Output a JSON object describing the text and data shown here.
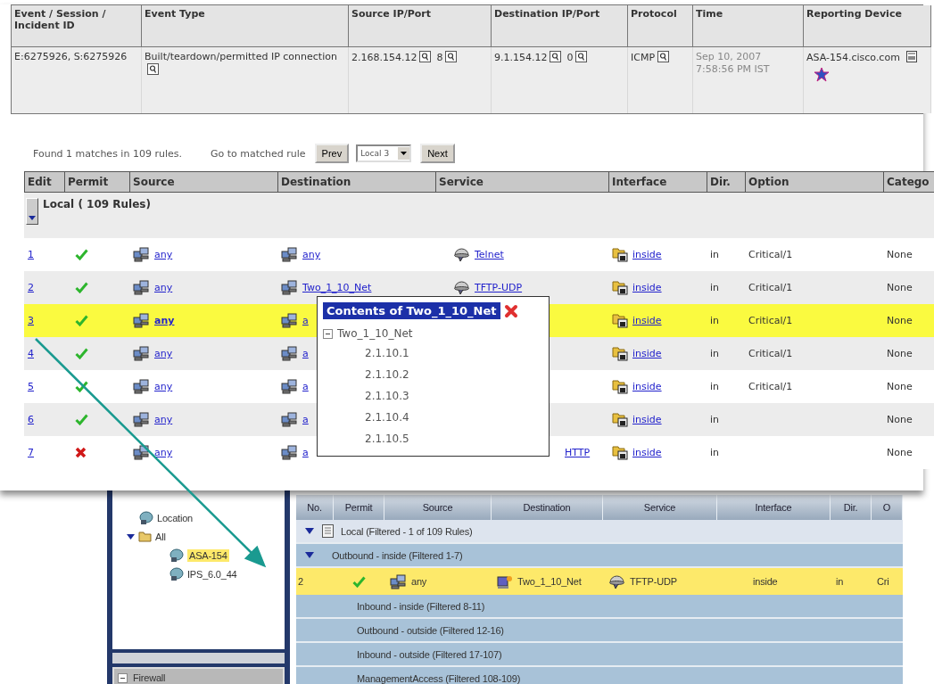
{
  "events_table": {
    "columns": [
      "Event / Session / Incident ID",
      "Event Type",
      "Source IP/Port",
      "Destination IP/Port",
      "Protocol",
      "Time",
      "Reporting Device"
    ],
    "rows": [
      {
        "cells": [
          {
            "text": "E:6275926, S:6275926",
            "query": false
          },
          {
            "text": "Built/teardown/permitted IP connection",
            "query": true
          },
          {
            "text": "2.168.154.12",
            "query": true,
            "port": "8"
          },
          {
            "text": "9.1.154.12",
            "query": true,
            "port": "0"
          },
          {
            "text": "ICMP",
            "query": true
          },
          {
            "text": "Sep 10, 2007 7:58:56 PM IST",
            "query": false
          },
          {
            "text": "ASA-154.cisco.com",
            "query": false
          }
        ]
      }
    ]
  },
  "rule_search": {
    "summary": "Found 1 matches in 109 rules.",
    "goto_label": "Go to matched rule",
    "prev": "Prev",
    "select_value": "Local 3",
    "next": "Next"
  },
  "rules_table": {
    "columns": [
      "Edit",
      "Permit",
      "Source",
      "Destination",
      "Service",
      "Interface",
      "Dir.",
      "Option",
      "Catego"
    ],
    "group": {
      "label": "Local ( 109 Rules)",
      "expanded": true
    },
    "rows": [
      {
        "number": "1",
        "permit": true,
        "source": "any",
        "destination": "any",
        "service": "Telnet",
        "interface": "inside",
        "direction": "in",
        "option": "Critical/1",
        "category": "None",
        "selected": false
      },
      {
        "number": "2",
        "permit": true,
        "source": "any",
        "destination": "Two_1_10_Net",
        "service": "TFTP-UDP",
        "interface": "inside",
        "direction": "in",
        "option": "Critical/1",
        "category": "None",
        "selected": false
      },
      {
        "number": "3",
        "permit": true,
        "source": "any",
        "destination": "a",
        "interface": "inside",
        "direction": "in",
        "option": "Critical/1",
        "category": "None",
        "selected": true
      },
      {
        "number": "4",
        "permit": true,
        "source": "any",
        "destination": "a",
        "interface": "inside",
        "direction": "in",
        "option": "Critical/1",
        "category": "None",
        "selected": false
      },
      {
        "number": "5",
        "permit": true,
        "source": "any",
        "destination": "a",
        "interface": "inside",
        "direction": "in",
        "option": "Critical/1",
        "category": "None",
        "selected": false
      },
      {
        "number": "6",
        "permit": true,
        "source": "any",
        "destination": "a",
        "interface": "inside",
        "direction": "in",
        "category": "None",
        "selected": false
      },
      {
        "number": "7",
        "permit": false,
        "source": "any",
        "destination": "a",
        "service": "HTTP",
        "interface": "inside",
        "direction": "in",
        "category": "None",
        "selected": false
      }
    ]
  },
  "popup": {
    "title": "Contents of Two_1_10_Net",
    "root": {
      "label": "Two_1_10_Net",
      "expanded": true,
      "children": [
        {
          "label": "2.1.10.1"
        },
        {
          "label": "2.1.10.2"
        },
        {
          "label": "2.1.10.3"
        },
        {
          "label": "2.1.10.4"
        },
        {
          "label": "2.1.10.5"
        }
      ]
    }
  },
  "device_panel": {
    "tree": [
      {
        "label": "Location",
        "expanded": false,
        "selected": false
      },
      {
        "label": "All",
        "expanded": true,
        "selected": false,
        "children": [
          {
            "label": "ASA-154",
            "selected": true
          },
          {
            "label": "IPS_6.0_44",
            "selected": false
          }
        ]
      }
    ],
    "footer": "Firewall"
  },
  "policy_table": {
    "columns": [
      "No.",
      "Permit",
      "Source",
      "Destination",
      "Service",
      "Interface",
      "Dir.",
      "O"
    ],
    "rows": [
      {
        "kind": "group",
        "label": "Local (Filtered - 1 of 109 Rules)",
        "expanded": true,
        "selected": false
      },
      {
        "kind": "subgroup",
        "label": "Outbound - inside (Filtered 1-7)",
        "expanded": true,
        "selected": false
      },
      {
        "kind": "rule",
        "number": "2",
        "permit": true,
        "source": "any",
        "destination": "Two_1_10_Net",
        "service": "TFTP-UDP",
        "interface": "inside",
        "direction": "in",
        "option": "Cri",
        "selected": true
      },
      {
        "kind": "subgroup",
        "label": "Inbound - inside (Filtered 8-11)",
        "expanded": false,
        "selected": false
      },
      {
        "kind": "subgroup",
        "label": "Outbound - outside (Filtered 12-16)",
        "expanded": false,
        "selected": false
      },
      {
        "kind": "subgroup",
        "label": "Inbound - outside (Filtered 17-107)",
        "expanded": false,
        "selected": false
      },
      {
        "kind": "subgroup",
        "label": "ManagementAccess (Filtered 108-109)",
        "expanded": false,
        "selected": false
      }
    ]
  }
}
